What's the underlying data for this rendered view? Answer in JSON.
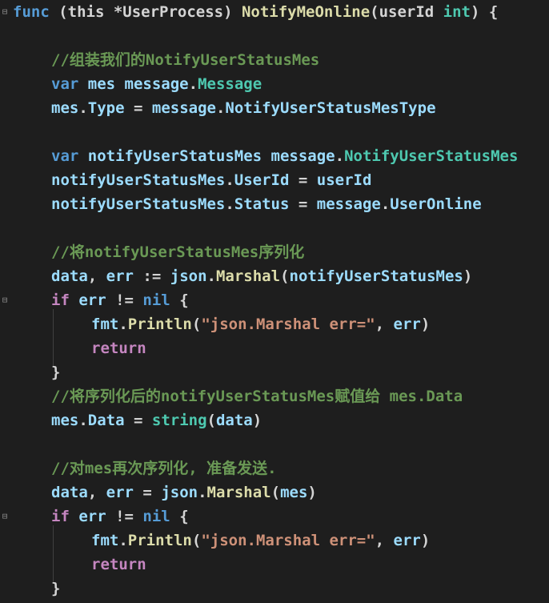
{
  "code_lines": [
    {
      "tokens": [
        {
          "t": "func",
          "c": "kw"
        },
        {
          "t": " (this *UserProcess) ",
          "c": "sig"
        },
        {
          "t": "NotifyMeOnline",
          "c": "fn"
        },
        {
          "t": "(userId ",
          "c": "sig"
        },
        {
          "t": "int",
          "c": "type"
        },
        {
          "t": ") {",
          "c": "sig"
        }
      ]
    },
    {
      "tokens": []
    },
    {
      "tokens": [
        {
          "t": "//组装我们的NotifyUserStatusMes",
          "c": "cmt"
        }
      ]
    },
    {
      "tokens": [
        {
          "t": "var",
          "c": "kw"
        },
        {
          "t": " mes ",
          "c": "var"
        },
        {
          "t": "message",
          "c": "var"
        },
        {
          "t": ".",
          "c": "plain"
        },
        {
          "t": "Message",
          "c": "type"
        }
      ]
    },
    {
      "tokens": [
        {
          "t": "mes",
          "c": "var"
        },
        {
          "t": ".",
          "c": "plain"
        },
        {
          "t": "Type",
          "c": "var"
        },
        {
          "t": " = ",
          "c": "plain"
        },
        {
          "t": "message",
          "c": "var"
        },
        {
          "t": ".",
          "c": "plain"
        },
        {
          "t": "NotifyUserStatusMesType",
          "c": "var"
        }
      ]
    },
    {
      "tokens": []
    },
    {
      "tokens": [
        {
          "t": "var",
          "c": "kw"
        },
        {
          "t": " notifyUserStatusMes ",
          "c": "var"
        },
        {
          "t": "message",
          "c": "var"
        },
        {
          "t": ".",
          "c": "plain"
        },
        {
          "t": "NotifyUserStatusMes",
          "c": "type"
        }
      ]
    },
    {
      "tokens": [
        {
          "t": "notifyUserStatusMes",
          "c": "var"
        },
        {
          "t": ".",
          "c": "plain"
        },
        {
          "t": "UserId",
          "c": "var"
        },
        {
          "t": " = ",
          "c": "plain"
        },
        {
          "t": "userId",
          "c": "var"
        }
      ]
    },
    {
      "tokens": [
        {
          "t": "notifyUserStatusMes",
          "c": "var"
        },
        {
          "t": ".",
          "c": "plain"
        },
        {
          "t": "Status",
          "c": "var"
        },
        {
          "t": " = ",
          "c": "plain"
        },
        {
          "t": "message",
          "c": "var"
        },
        {
          "t": ".",
          "c": "plain"
        },
        {
          "t": "UserOnline",
          "c": "var"
        }
      ]
    },
    {
      "tokens": []
    },
    {
      "tokens": [
        {
          "t": "//将notifyUserStatusMes序列化",
          "c": "cmt"
        }
      ]
    },
    {
      "tokens": [
        {
          "t": "data",
          "c": "var"
        },
        {
          "t": ", ",
          "c": "plain"
        },
        {
          "t": "err",
          "c": "var"
        },
        {
          "t": " := ",
          "c": "plain"
        },
        {
          "t": "json",
          "c": "var"
        },
        {
          "t": ".",
          "c": "plain"
        },
        {
          "t": "Marshal",
          "c": "fn"
        },
        {
          "t": "(",
          "c": "plain"
        },
        {
          "t": "notifyUserStatusMes",
          "c": "var"
        },
        {
          "t": ")",
          "c": "plain"
        }
      ]
    },
    {
      "tokens": [
        {
          "t": "if",
          "c": "kw-ctl"
        },
        {
          "t": " err ",
          "c": "var"
        },
        {
          "t": "!= ",
          "c": "plain"
        },
        {
          "t": "nil",
          "c": "kw"
        },
        {
          "t": " {",
          "c": "plain"
        }
      ]
    },
    {
      "tokens": [
        {
          "t": "fmt",
          "c": "var"
        },
        {
          "t": ".",
          "c": "plain"
        },
        {
          "t": "Println",
          "c": "fn"
        },
        {
          "t": "(",
          "c": "plain"
        },
        {
          "t": "\"json.Marshal err=\"",
          "c": "str"
        },
        {
          "t": ", ",
          "c": "plain"
        },
        {
          "t": "err",
          "c": "var"
        },
        {
          "t": ")",
          "c": "plain"
        }
      ]
    },
    {
      "tokens": [
        {
          "t": "return",
          "c": "kw-ctl"
        }
      ]
    },
    {
      "tokens": [
        {
          "t": "}",
          "c": "plain"
        }
      ]
    },
    {
      "tokens": [
        {
          "t": "//将序列化后的notifyUserStatusMes赋值给 mes.Data",
          "c": "cmt"
        }
      ]
    },
    {
      "tokens": [
        {
          "t": "mes",
          "c": "var"
        },
        {
          "t": ".",
          "c": "plain"
        },
        {
          "t": "Data",
          "c": "var"
        },
        {
          "t": " = ",
          "c": "plain"
        },
        {
          "t": "string",
          "c": "type"
        },
        {
          "t": "(",
          "c": "plain"
        },
        {
          "t": "data",
          "c": "var"
        },
        {
          "t": ")",
          "c": "plain"
        }
      ]
    },
    {
      "tokens": []
    },
    {
      "tokens": [
        {
          "t": "//对mes再次序列化, 准备发送.",
          "c": "cmt"
        }
      ]
    },
    {
      "tokens": [
        {
          "t": "data",
          "c": "var"
        },
        {
          "t": ", ",
          "c": "plain"
        },
        {
          "t": "err",
          "c": "var"
        },
        {
          "t": " = ",
          "c": "plain"
        },
        {
          "t": "json",
          "c": "var"
        },
        {
          "t": ".",
          "c": "plain"
        },
        {
          "t": "Marshal",
          "c": "fn"
        },
        {
          "t": "(",
          "c": "plain"
        },
        {
          "t": "mes",
          "c": "var"
        },
        {
          "t": ")",
          "c": "plain"
        }
      ]
    },
    {
      "tokens": [
        {
          "t": "if",
          "c": "kw-ctl"
        },
        {
          "t": " err ",
          "c": "var"
        },
        {
          "t": "!= ",
          "c": "plain"
        },
        {
          "t": "nil",
          "c": "kw"
        },
        {
          "t": " {",
          "c": "plain"
        }
      ]
    },
    {
      "tokens": [
        {
          "t": "fmt",
          "c": "var"
        },
        {
          "t": ".",
          "c": "plain"
        },
        {
          "t": "Println",
          "c": "fn"
        },
        {
          "t": "(",
          "c": "plain"
        },
        {
          "t": "\"json.Marshal err=\"",
          "c": "str"
        },
        {
          "t": ", ",
          "c": "plain"
        },
        {
          "t": "err",
          "c": "var"
        },
        {
          "t": ")",
          "c": "plain"
        }
      ]
    },
    {
      "tokens": [
        {
          "t": "return",
          "c": "kw-ctl"
        }
      ]
    },
    {
      "tokens": [
        {
          "t": "}",
          "c": "plain"
        }
      ]
    }
  ],
  "fold_marker": "⊟",
  "colors": {
    "background": "#1e1e1e",
    "keyword": "#569cd6",
    "control": "#c586c0",
    "variable": "#9cdcfe",
    "function": "#dcdcaa",
    "type": "#4ec9b0",
    "string": "#ce9178",
    "comment": "#6a9955"
  }
}
